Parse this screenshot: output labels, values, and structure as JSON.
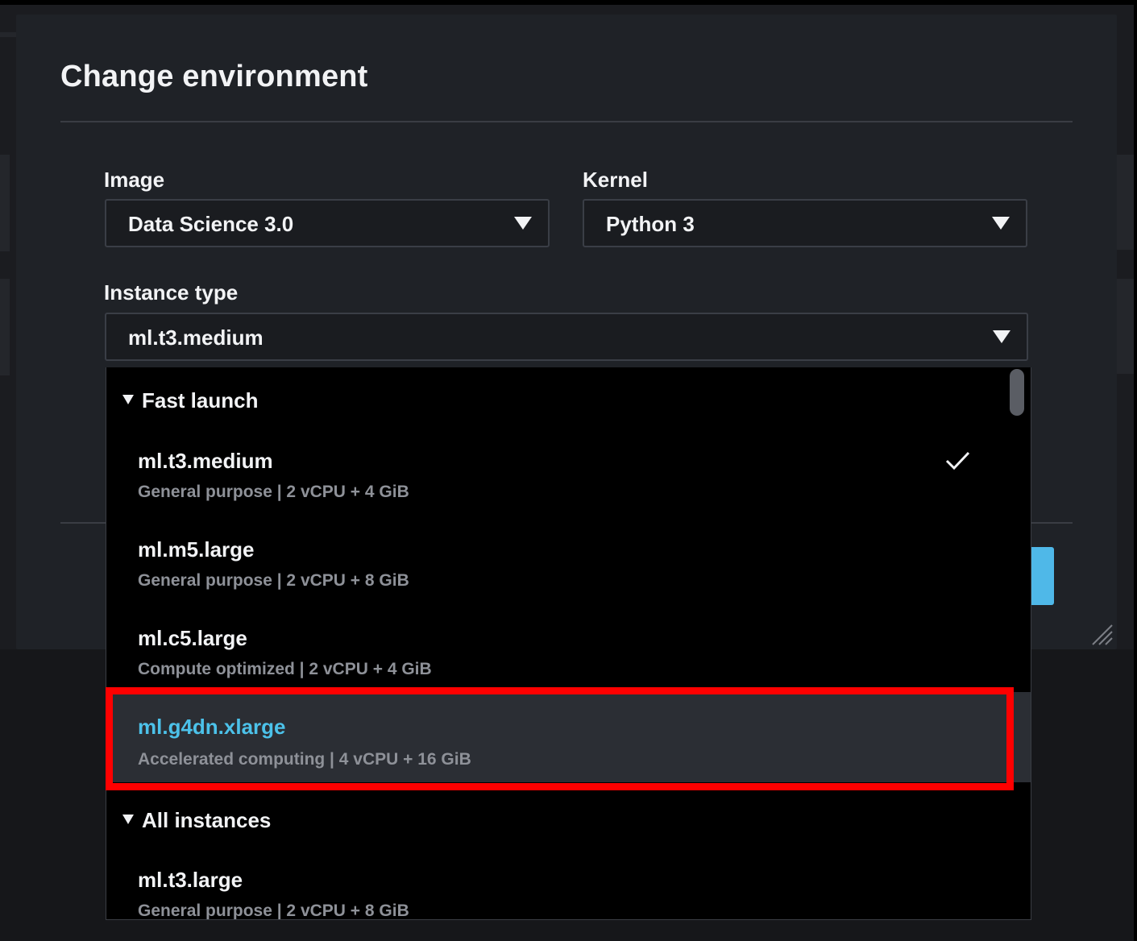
{
  "dialog": {
    "title": "Change environment"
  },
  "fields": {
    "image": {
      "label": "Image",
      "value": "Data Science 3.0"
    },
    "kernel": {
      "label": "Kernel",
      "value": "Python 3"
    },
    "instance_type": {
      "label": "Instance type",
      "value": "ml.t3.medium"
    }
  },
  "dropdown": {
    "groups": [
      {
        "label": "Fast launch",
        "options": [
          {
            "name": "ml.t3.medium",
            "description": "General purpose | 2 vCPU + 4 GiB",
            "selected": true
          },
          {
            "name": "ml.m5.large",
            "description": "General purpose | 2 vCPU + 8 GiB"
          },
          {
            "name": "ml.c5.large",
            "description": "Compute optimized | 2 vCPU + 4 GiB"
          },
          {
            "name": "ml.g4dn.xlarge",
            "description": "Accelerated computing | 4 vCPU + 16 GiB",
            "highlighted": true
          }
        ]
      },
      {
        "label": "All instances",
        "options": [
          {
            "name": "ml.t3.large",
            "description": "General purpose | 2 vCPU + 8 GiB"
          }
        ]
      }
    ]
  },
  "colors": {
    "accent": "#4cc2ea",
    "primary_button": "#4fb8e8",
    "annotation_box": "#ff0000"
  },
  "icons": {
    "dropdown_caret": "chevron-down-icon",
    "group_toggle": "triangle-down-icon",
    "selected_mark": "checkmark-icon"
  }
}
